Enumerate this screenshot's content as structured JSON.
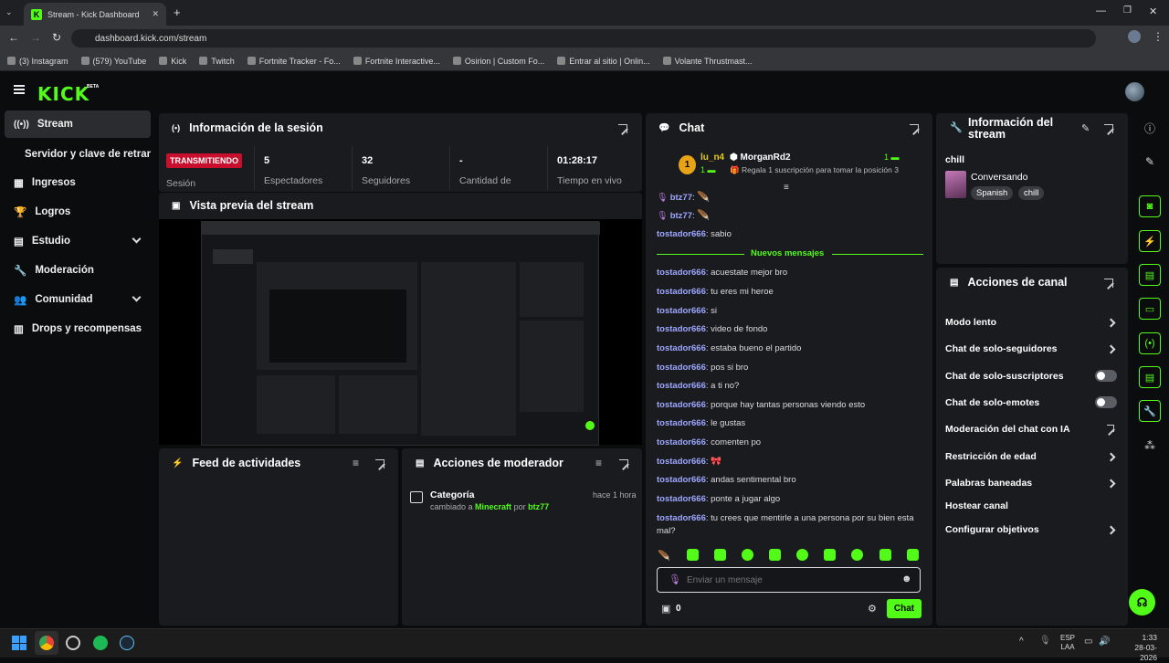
{
  "browser": {
    "tab_title": "Stream - Kick Dashboard",
    "url": "dashboard.kick.com/stream",
    "bookmarks": [
      "(3) Instagram",
      "(579) YouTube",
      "Kick",
      "Twitch",
      "Fortnite Tracker - Fo...",
      "Fortnite Interactive...",
      "Osirion | Custom Fo...",
      "Entrar al sitio | Onlin...",
      "Volante Thrustmast..."
    ]
  },
  "app": {
    "logo": "KICK",
    "beta": "BETA"
  },
  "sidebar": {
    "items": [
      {
        "label": "Stream"
      },
      {
        "label": "Servidor y clave de retransmisión"
      },
      {
        "label": "Ingresos"
      },
      {
        "label": "Logros"
      },
      {
        "label": "Estudio"
      },
      {
        "label": "Moderación"
      },
      {
        "label": "Comunidad"
      },
      {
        "label": "Drops y recompensas"
      }
    ]
  },
  "session": {
    "title": "Información de la sesión",
    "badge": "TRANSMITIENDO",
    "badge_label": "Sesión",
    "stats": [
      {
        "value": "5",
        "label": "Espectadores"
      },
      {
        "value": "32",
        "label": "Seguidores"
      },
      {
        "value": "-",
        "label": "Cantidad de"
      },
      {
        "value": "01:28:17",
        "label": "Tiempo en vivo"
      }
    ]
  },
  "preview": {
    "title": "Vista previa del stream"
  },
  "activity": {
    "title": "Feed de actividades"
  },
  "mod_actions": {
    "title": "Acciones de moderador",
    "entry": {
      "heading": "Categoría",
      "time": "hace 1 hora",
      "prefix": "cambiado a",
      "value": "Minecraft",
      "by": "por",
      "user": "btz77"
    }
  },
  "chat": {
    "title": "Chat",
    "leader1": {
      "name": "lu_n4",
      "rank": "1",
      "count": "1"
    },
    "leader2": {
      "name": "MorganRd2",
      "count": "1",
      "sub": "Regala 1 suscripción para tomar la posición 3"
    },
    "new_messages": "Nuevos mensajes",
    "messages_before": [
      {
        "user": "btz77",
        "text": ""
      },
      {
        "user": "btz77",
        "text": ""
      },
      {
        "user": "tostador666",
        "text": "sabio"
      }
    ],
    "messages_after": [
      {
        "user": "tostador666",
        "text": "acuestate mejor bro"
      },
      {
        "user": "tostador666",
        "text": "tu eres mi heroe"
      },
      {
        "user": "tostador666",
        "text": "si"
      },
      {
        "user": "tostador666",
        "text": "video de fondo"
      },
      {
        "user": "tostador666",
        "text": "estaba bueno el partido"
      },
      {
        "user": "tostador666",
        "text": "pos si bro"
      },
      {
        "user": "tostador666",
        "text": "a ti no?"
      },
      {
        "user": "tostador666",
        "text": "porque hay tantas personas viendo esto"
      },
      {
        "user": "tostador666",
        "text": "le gustas"
      },
      {
        "user": "tostador666",
        "text": "comenten po"
      },
      {
        "user": "tostador666",
        "text": ""
      },
      {
        "user": "tostador666",
        "text": "andas sentimental bro"
      },
      {
        "user": "tostador666",
        "text": "ponte a jugar algo"
      },
      {
        "user": "tostador666",
        "text": "tu crees que mentirle a una persona por su bien esta mal?"
      }
    ],
    "input_placeholder": "Enviar un mensaje",
    "points": "0",
    "send_label": "Chat"
  },
  "stream_info": {
    "title": "Información del stream",
    "stream_title": "chill",
    "category": "Conversando",
    "tags": [
      "Spanish",
      "chill"
    ]
  },
  "channel_actions": {
    "title": "Acciones de canal",
    "items": [
      {
        "label": "Modo lento"
      },
      {
        "label": "Chat de solo-seguidores"
      },
      {
        "label": "Chat de solo-suscriptores"
      },
      {
        "label": "Chat de solo-emotes"
      },
      {
        "label": "Moderación del chat con IA"
      },
      {
        "label": "Restricción de edad"
      },
      {
        "label": "Palabras baneadas"
      },
      {
        "label": "Hostear canal"
      },
      {
        "label": "Configurar objetivos"
      }
    ]
  },
  "taskbar": {
    "lang_top": "ESP",
    "lang_bottom": "LAA",
    "time": "1:33",
    "date": "28-03-2026"
  },
  "colors": {
    "accent": "#53fc18",
    "live": "#c8102e",
    "panel": "#191b1f"
  }
}
